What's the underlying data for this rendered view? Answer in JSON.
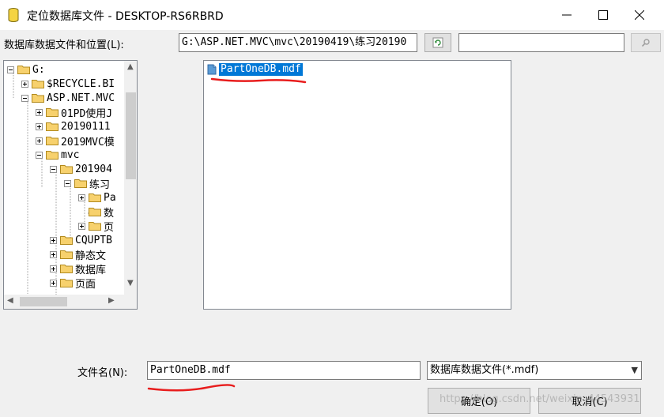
{
  "window": {
    "title": "定位数据库文件 - DESKTOP-RS6RBRD",
    "icon": "database-icon"
  },
  "location": {
    "label": "数据库数据文件和位置(L):",
    "path_value": "G:\\ASP.NET.MVC\\mvc\\20190419\\练习20190",
    "search_value": ""
  },
  "tree": {
    "items": [
      {
        "label": "G:",
        "expander": "minus"
      },
      {
        "label": "$RECYCLE.BI",
        "expander": "plus"
      },
      {
        "label": "ASP.NET.MVC",
        "expander": "minus"
      },
      {
        "label": "01PD使用J",
        "expander": "plus"
      },
      {
        "label": "20190111",
        "expander": "plus"
      },
      {
        "label": "2019MVC模",
        "expander": "plus"
      },
      {
        "label": "mvc",
        "expander": "minus"
      },
      {
        "label": "201904",
        "expander": "minus"
      },
      {
        "label": "练习",
        "expander": "minus"
      },
      {
        "label": "Pa",
        "expander": "plus"
      },
      {
        "label": "数",
        "expander": "none"
      },
      {
        "label": "页",
        "expander": "plus"
      },
      {
        "label": "CQUPTB",
        "expander": "plus"
      },
      {
        "label": "静态文",
        "expander": "plus"
      },
      {
        "label": "数据库",
        "expander": "plus"
      },
      {
        "label": "页面",
        "expander": "plus"
      }
    ]
  },
  "files": {
    "items": [
      {
        "label": "PartOneDB.mdf",
        "selected": true
      }
    ]
  },
  "filename": {
    "label": "文件名(N):",
    "value": "PartOneDB.mdf"
  },
  "filetype": {
    "selected": "数据库数据文件(*.mdf)"
  },
  "buttons": {
    "ok_label": "确定(O)",
    "cancel_label": "取消(C)"
  },
  "watermark": "https://blog.csdn.net/weixin_44543931",
  "colors": {
    "selection": "#0078d7",
    "folder": "#f7d16d",
    "annotation": "#e81d1d"
  }
}
